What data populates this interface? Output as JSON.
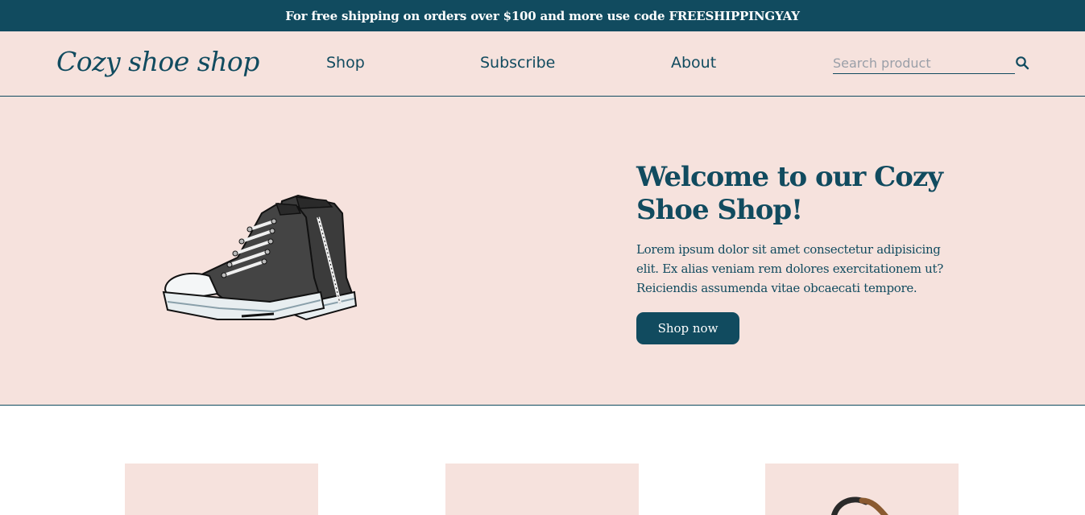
{
  "promo": {
    "text": "For free shipping on orders over $100 and more use code FREESHIPPINGYAY"
  },
  "header": {
    "logo": "Cozy shoe shop",
    "nav": [
      {
        "label": "Shop"
      },
      {
        "label": "Subscribe"
      },
      {
        "label": "About"
      }
    ],
    "search": {
      "placeholder": "Search product",
      "value": "",
      "icon": "search-icon"
    }
  },
  "hero": {
    "title": "Welcome to our Cozy Shoe Shop!",
    "text": "Lorem ipsum dolor sit amet consectetur adipisicing elit. Ex alias veniam rem dolores exercitationem ut? Reiciendis assumenda vitae obcaecati tempore.",
    "button_label": "Shop now",
    "image": "sneakers-illustration"
  },
  "products": [
    {
      "image": "product-image-1"
    },
    {
      "image": "product-image-2"
    },
    {
      "image": "product-image-3"
    }
  ],
  "colors": {
    "primary": "#114b5f",
    "background_pink": "#f6e2dd",
    "white": "#ffffff"
  }
}
